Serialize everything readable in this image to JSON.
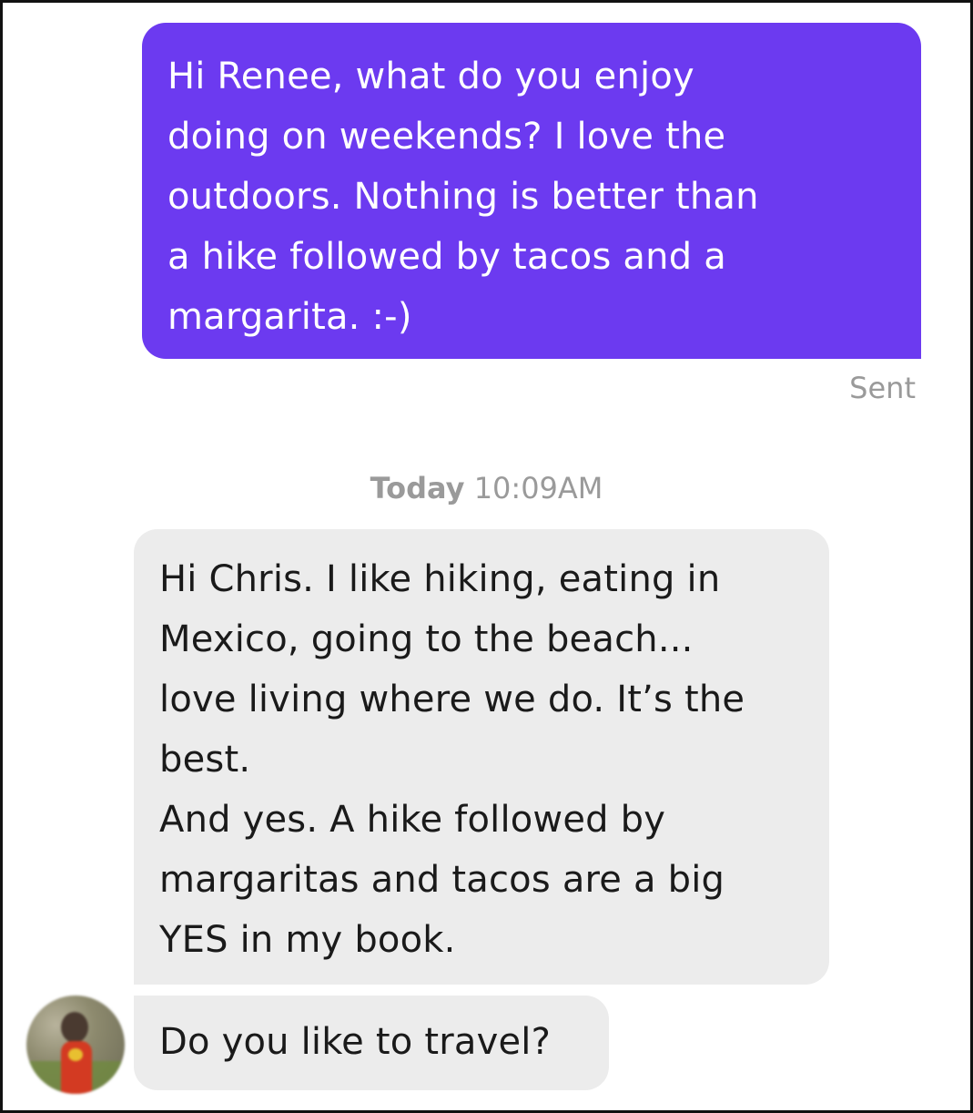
{
  "conversation": {
    "messages": [
      {
        "direction": "sent",
        "text": "Hi Renee, what do you enjoy\ndoing on weekends? I love the\noutdoors. Nothing is better than\na hike followed by tacos and a\nmargarita. :-)"
      },
      {
        "direction": "received",
        "text": "Hi Chris. I like hiking, eating in\nMexico, going to the beach...\nlove living where we do. It’s the\nbest.\nAnd yes. A hike followed by\nmargaritas and tacos are a big\nYES in my book."
      },
      {
        "direction": "received",
        "text": "Do you like to travel?"
      }
    ],
    "sent_status": "Sent",
    "timestamp": {
      "day": "Today",
      "time": "10:09AM"
    },
    "avatar": {
      "icon": "user-avatar-photo"
    }
  },
  "colors": {
    "sent_bubble": "#6c3af0",
    "received_bubble": "#ececec",
    "meta_text": "#9a9a9a"
  }
}
